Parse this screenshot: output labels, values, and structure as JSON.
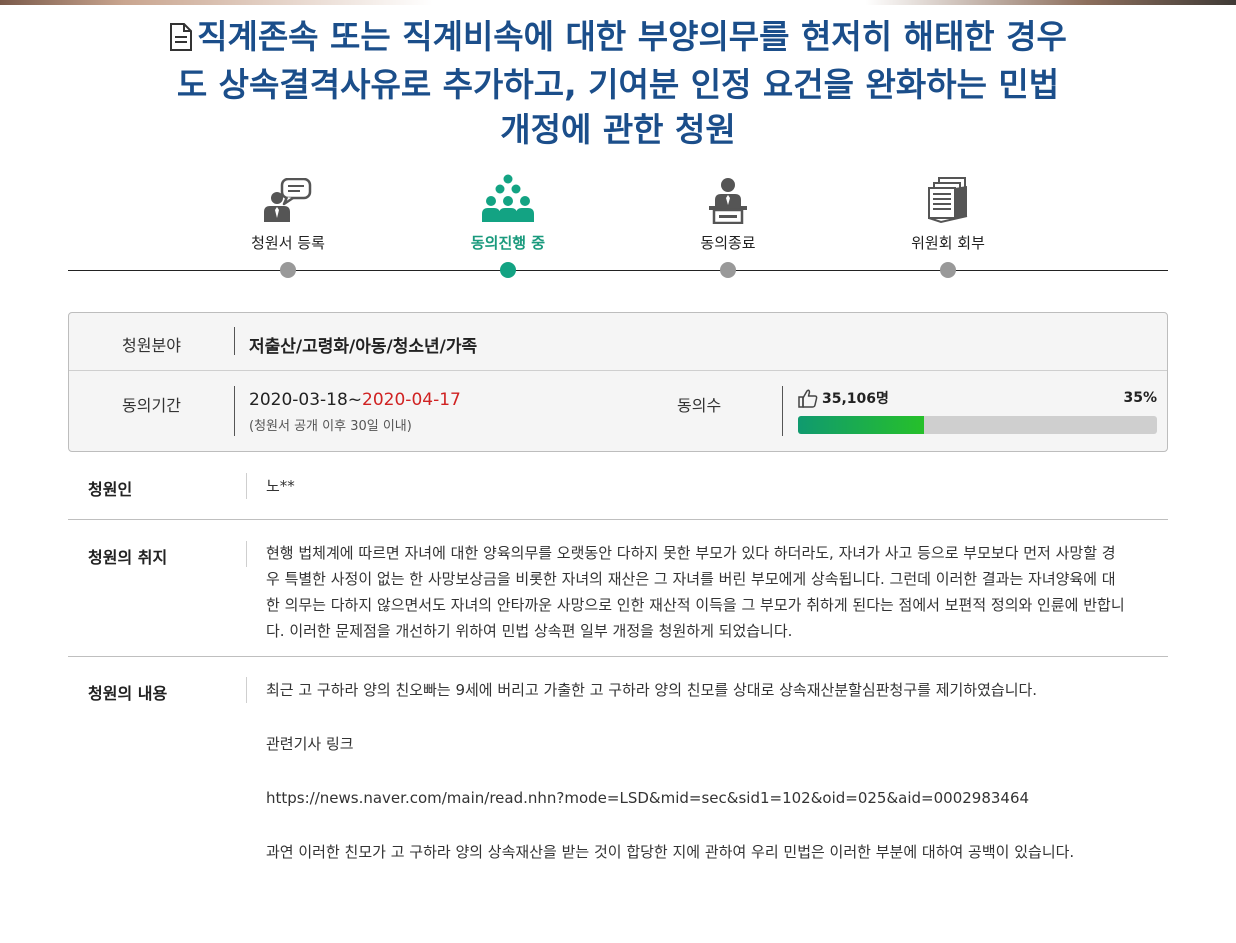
{
  "title": "직계존속 또는 직계비속에 대한 부양의무를 현저히 해태한 경우도 상속결격사유로 추가하고, 기여분 인정 요건을 완화하는 민법 개정에 관한 청원",
  "colors": {
    "title": "#1b4e8a",
    "active_step": "#13a383",
    "deadline": "#d02222",
    "bar_start": "#109a6f",
    "bar_end": "#26c02a"
  },
  "steps": [
    {
      "label": "청원서 등록",
      "icon": "speech-person-icon",
      "active": false
    },
    {
      "label": "동의진행 중",
      "icon": "group-people-icon",
      "active": true
    },
    {
      "label": "동의종료",
      "icon": "podium-speaker-icon",
      "active": false
    },
    {
      "label": "위원회 회부",
      "icon": "document-stack-icon",
      "active": false
    }
  ],
  "info": {
    "field_label": "청원분야",
    "field_value": "저출산/고령화/아동/청소년/가족",
    "period_label": "동의기간",
    "period_start": "2020-03-18~",
    "period_end": "2020-04-17",
    "period_note": "(청원서 공개 이후 30일 이내)",
    "agree_label": "동의수",
    "agree_count": "35,106명",
    "agree_percent": "35%",
    "agree_progress": 0.35
  },
  "petitioner": {
    "label": "청원인",
    "value": "노**"
  },
  "purpose": {
    "label": "청원의 취지",
    "text": " 현행 법체계에 따르면 자녀에 대한 양육의무를 오랫동안 다하지 못한 부모가 있다 하더라도, 자녀가 사고 등으로 부모보다 먼저 사망할 경우 특별한 사정이 없는 한 사망보상금을 비롯한 자녀의 재산은 그 자녀를 버린 부모에게 상속됩니다. 그런데 이러한 결과는 자녀양육에 대한 의무는 다하지 않으면서도 자녀의 안타까운 사망으로 인한 재산적 이득을 그 부모가 취하게 된다는 점에서 보편적 정의와 인륜에 반합니다. 이러한 문제점을 개선하기 위하여 민법 상속편 일부 개정을 청원하게 되었습니다."
  },
  "content": {
    "label": "청원의 내용",
    "paragraphs": [
      "최근 고 구하라 양의 친오빠는 9세에 버리고 가출한 고 구하라 양의 친모를 상대로 상속재산분할심판청구를 제기하였습니다.",
      "관련기사 링크",
      "https://news.naver.com/main/read.nhn?mode=LSD&mid=sec&sid1=102&oid=025&aid=0002983464",
      "과연 이러한 친모가 고 구하라 양의 상속재산을 받는 것이 합당한 지에 관하여 우리 민법은 이러한 부분에 대하여 공백이 있습니다."
    ]
  }
}
